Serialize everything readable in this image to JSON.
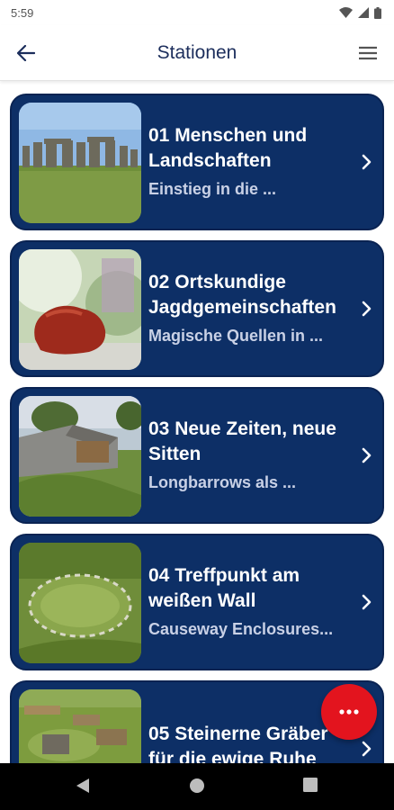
{
  "status_bar": {
    "time": "5:59",
    "icons": [
      "wifi-icon",
      "signal-icon",
      "battery-icon"
    ]
  },
  "app_bar": {
    "title": "Stationen",
    "back_icon": "arrow-left-icon",
    "menu_icon": "hamburger-menu-icon"
  },
  "stations": [
    {
      "title_line1": "01 Menschen und",
      "title_line2": "Landschaften",
      "subtitle": "Einstieg in die ..."
    },
    {
      "title_line1": "02 Ortskundige",
      "title_line2": "Jagdgemeinschaften",
      "subtitle": "Magische Quellen in ..."
    },
    {
      "title_line1": "03 Neue Zeiten, neue",
      "title_line2": "Sitten",
      "subtitle": "Longbarrows als ..."
    },
    {
      "title_line1": "04 Treffpunkt am",
      "title_line2": "weißen Wall",
      "subtitle": "Causeway Enclosures..."
    },
    {
      "title_line1": "05 Steinerne Gräber",
      "title_line2": "für die ewige Ruhe",
      "subtitle": ""
    }
  ],
  "fab": {
    "icon": "more-horizontal-icon"
  },
  "nav_bar": {
    "icons": [
      "back-triangle-icon",
      "home-circle-icon",
      "recents-square-icon"
    ]
  },
  "colors": {
    "card_background": "#0d2f66",
    "title_text": "#1c2e5c",
    "fab": "#e3141e"
  }
}
